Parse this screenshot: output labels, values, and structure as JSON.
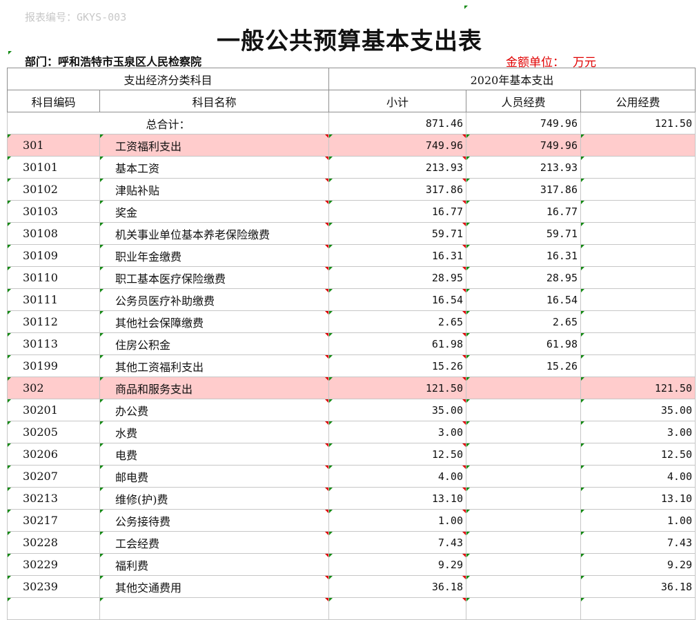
{
  "report_id": "报表编号：GKYS-003",
  "title": "一般公共预算基本支出表",
  "department": "部门：呼和浩特市玉泉区人民检察院",
  "unit_label": "金额单位：",
  "unit_value": "万元",
  "headers": {
    "classification": "支出经济分类科目",
    "year_total": "2020年基本支出",
    "code": "科目编码",
    "name": "科目名称",
    "subtotal": "小计",
    "personnel": "人员经费",
    "public": "公用经费"
  },
  "total": {
    "label": "总合计：",
    "subtotal": "871.46",
    "personnel": "749.96",
    "public": "121.50"
  },
  "rows": [
    {
      "code": "301",
      "name": "工资福利支出",
      "subtotal": "749.96",
      "personnel": "749.96",
      "public": "",
      "category": true
    },
    {
      "code": "30101",
      "name": "基本工资",
      "subtotal": "213.93",
      "personnel": "213.93",
      "public": ""
    },
    {
      "code": "30102",
      "name": "津贴补贴",
      "subtotal": "317.86",
      "personnel": "317.86",
      "public": ""
    },
    {
      "code": "30103",
      "name": "奖金",
      "subtotal": "16.77",
      "personnel": "16.77",
      "public": ""
    },
    {
      "code": "30108",
      "name": "机关事业单位基本养老保险缴费",
      "subtotal": "59.71",
      "personnel": "59.71",
      "public": ""
    },
    {
      "code": "30109",
      "name": "职业年金缴费",
      "subtotal": "16.31",
      "personnel": "16.31",
      "public": ""
    },
    {
      "code": "30110",
      "name": "职工基本医疗保险缴费",
      "subtotal": "28.95",
      "personnel": "28.95",
      "public": ""
    },
    {
      "code": "30111",
      "name": "公务员医疗补助缴费",
      "subtotal": "16.54",
      "personnel": "16.54",
      "public": ""
    },
    {
      "code": "30112",
      "name": "其他社会保障缴费",
      "subtotal": "2.65",
      "personnel": "2.65",
      "public": ""
    },
    {
      "code": "30113",
      "name": "住房公积金",
      "subtotal": "61.98",
      "personnel": "61.98",
      "public": ""
    },
    {
      "code": "30199",
      "name": "其他工资福利支出",
      "subtotal": "15.26",
      "personnel": "15.26",
      "public": ""
    },
    {
      "code": "302",
      "name": "商品和服务支出",
      "subtotal": "121.50",
      "personnel": "",
      "public": "121.50",
      "category": true
    },
    {
      "code": "30201",
      "name": "办公费",
      "subtotal": "35.00",
      "personnel": "",
      "public": "35.00"
    },
    {
      "code": "30205",
      "name": "水费",
      "subtotal": "3.00",
      "personnel": "",
      "public": "3.00"
    },
    {
      "code": "30206",
      "name": "电费",
      "subtotal": "12.50",
      "personnel": "",
      "public": "12.50"
    },
    {
      "code": "30207",
      "name": "邮电费",
      "subtotal": "4.00",
      "personnel": "",
      "public": "4.00"
    },
    {
      "code": "30213",
      "name": "维修(护)费",
      "subtotal": "13.10",
      "personnel": "",
      "public": "13.10"
    },
    {
      "code": "30217",
      "name": "公务接待费",
      "subtotal": "1.00",
      "personnel": "",
      "public": "1.00"
    },
    {
      "code": "30228",
      "name": "工会经费",
      "subtotal": "7.43",
      "personnel": "",
      "public": "7.43"
    },
    {
      "code": "30229",
      "name": "福利费",
      "subtotal": "9.29",
      "personnel": "",
      "public": "9.29"
    },
    {
      "code": "30239",
      "name": "其他交通费用",
      "subtotal": "36.18",
      "personnel": "",
      "public": "36.18"
    },
    {
      "code": "",
      "name": "",
      "subtotal": "",
      "personnel": "",
      "public": ""
    }
  ]
}
